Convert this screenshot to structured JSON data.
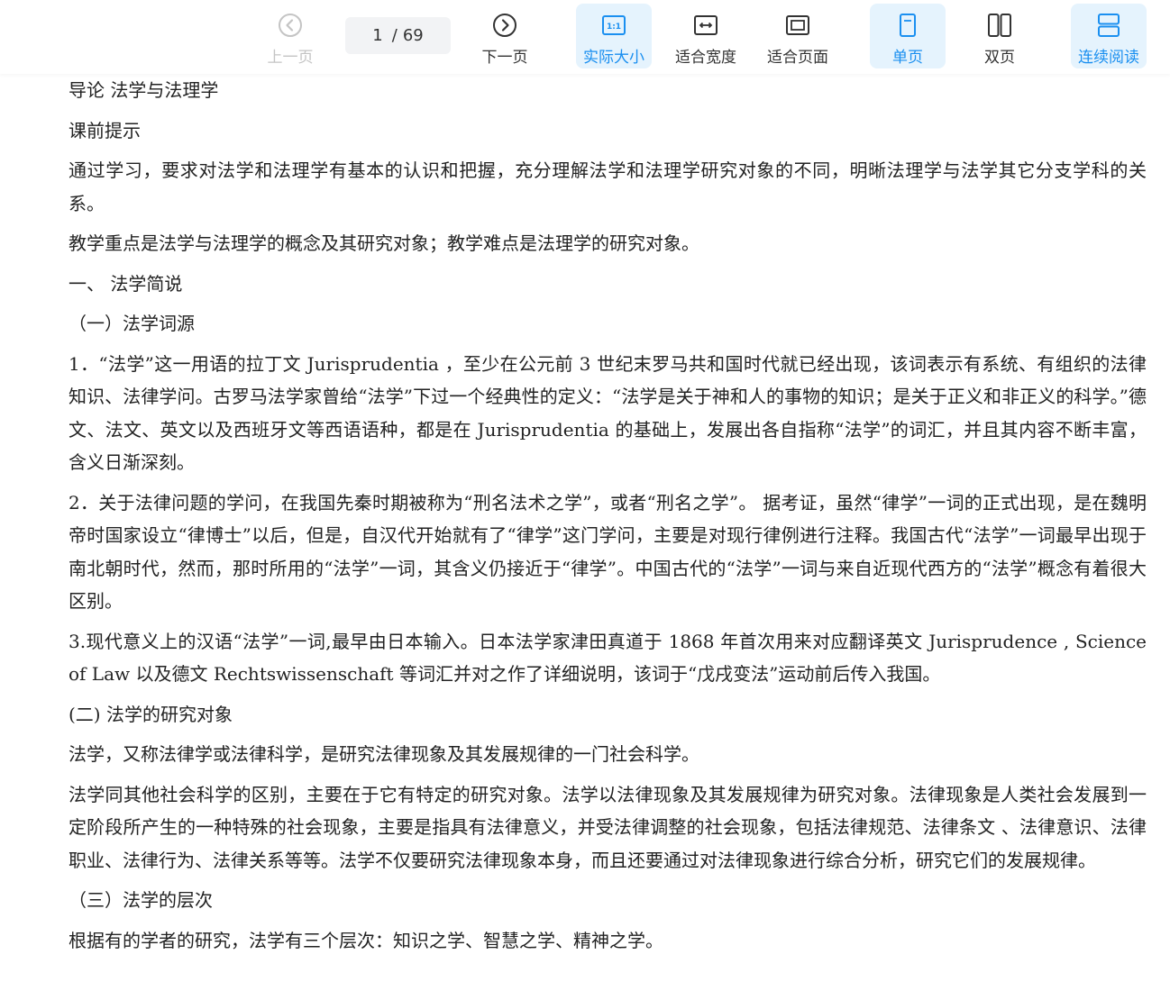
{
  "toolbar": {
    "prev_label": "上一页",
    "next_label": "下一页",
    "current_page": "1",
    "page_separator": "/",
    "total_pages": "69",
    "actual_size_label": "实际大小",
    "fit_width_label": "适合宽度",
    "fit_page_label": "适合页面",
    "single_page_label": "单页",
    "double_page_label": "双页",
    "continuous_label": "连续阅读",
    "accent_color": "#1a8ff0",
    "active_bg_color": "#e5f3fd"
  },
  "document": {
    "paragraphs": [
      "导论  法学与法理学",
      "课前提示",
      "通过学习，要求对法学和法理学有基本的认识和把握，充分理解法学和法理学研究对象的不同，明晰法理学与法学其它分支学科的关系。",
      "教学重点是法学与法理学的概念及其研究对象；教学难点是法理学的研究对象。",
      "一、  法学简说",
      "（一）法学词源",
      "1．“法学”这一用语的拉丁文 Jurisprudentia ，至少在公元前 3 世纪末罗马共和国时代就已经出现，该词表示有系统、有组织的法律知识、法律学问。古罗马法学家曾给“法学”下过一个经典性的定义：“法学是关于神和人的事物的知识；是关于正义和非正义的科学。”德文、法文、英文以及西班牙文等西语语种，都是在 Jurisprudentia 的基础上，发展出各自指称“法学”的词汇，并且其内容不断丰富，含义日渐深刻。",
      "2．关于法律问题的学问，在我国先秦时期被称为“刑名法术之学”，或者“刑名之学”。 据考证，虽然“律学”一词的正式出现，是在魏明帝时国家设立“律博士”以后，但是，自汉代开始就有了“律学”这门学问，主要是对现行律例进行注释。我国古代“法学”一词最早出现于南北朝时代，然而，那时所用的“法学”一词，其含义仍接近于“律学”。中国古代的“法学”一词与来自近现代西方的“法学”概念有着很大区别。",
      "3.现代意义上的汉语“法学”一词,最早由日本输入。日本法学家津田真道于 1868 年首次用来对应翻译英文 Jurisprudence , Science of Law 以及德文  Rechtswissenschaft 等词汇并对之作了详细说明，该词于“戊戌变法”运动前后传入我国。",
      "(二) 法学的研究对象",
      "法学，又称法律学或法律科学，是研究法律现象及其发展规律的一门社会科学。",
      "法学同其他社会科学的区别，主要在于它有特定的研究对象。法学以法律现象及其发展规律为研究对象。法律现象是人类社会发展到一定阶段所产生的一种特殊的社会现象，主要是指具有法律意义，并受法律调整的社会现象，包括法律规范、法律条文 、法律意识、法律职业、法律行为、法律关系等等。法学不仅要研究法律现象本身，而且还要通过对法律现象进行综合分析，研究它们的发展规律。",
      "（三）法学的层次",
      "根据有的学者的研究，法学有三个层次：知识之学、智慧之学、精神之学。"
    ]
  }
}
